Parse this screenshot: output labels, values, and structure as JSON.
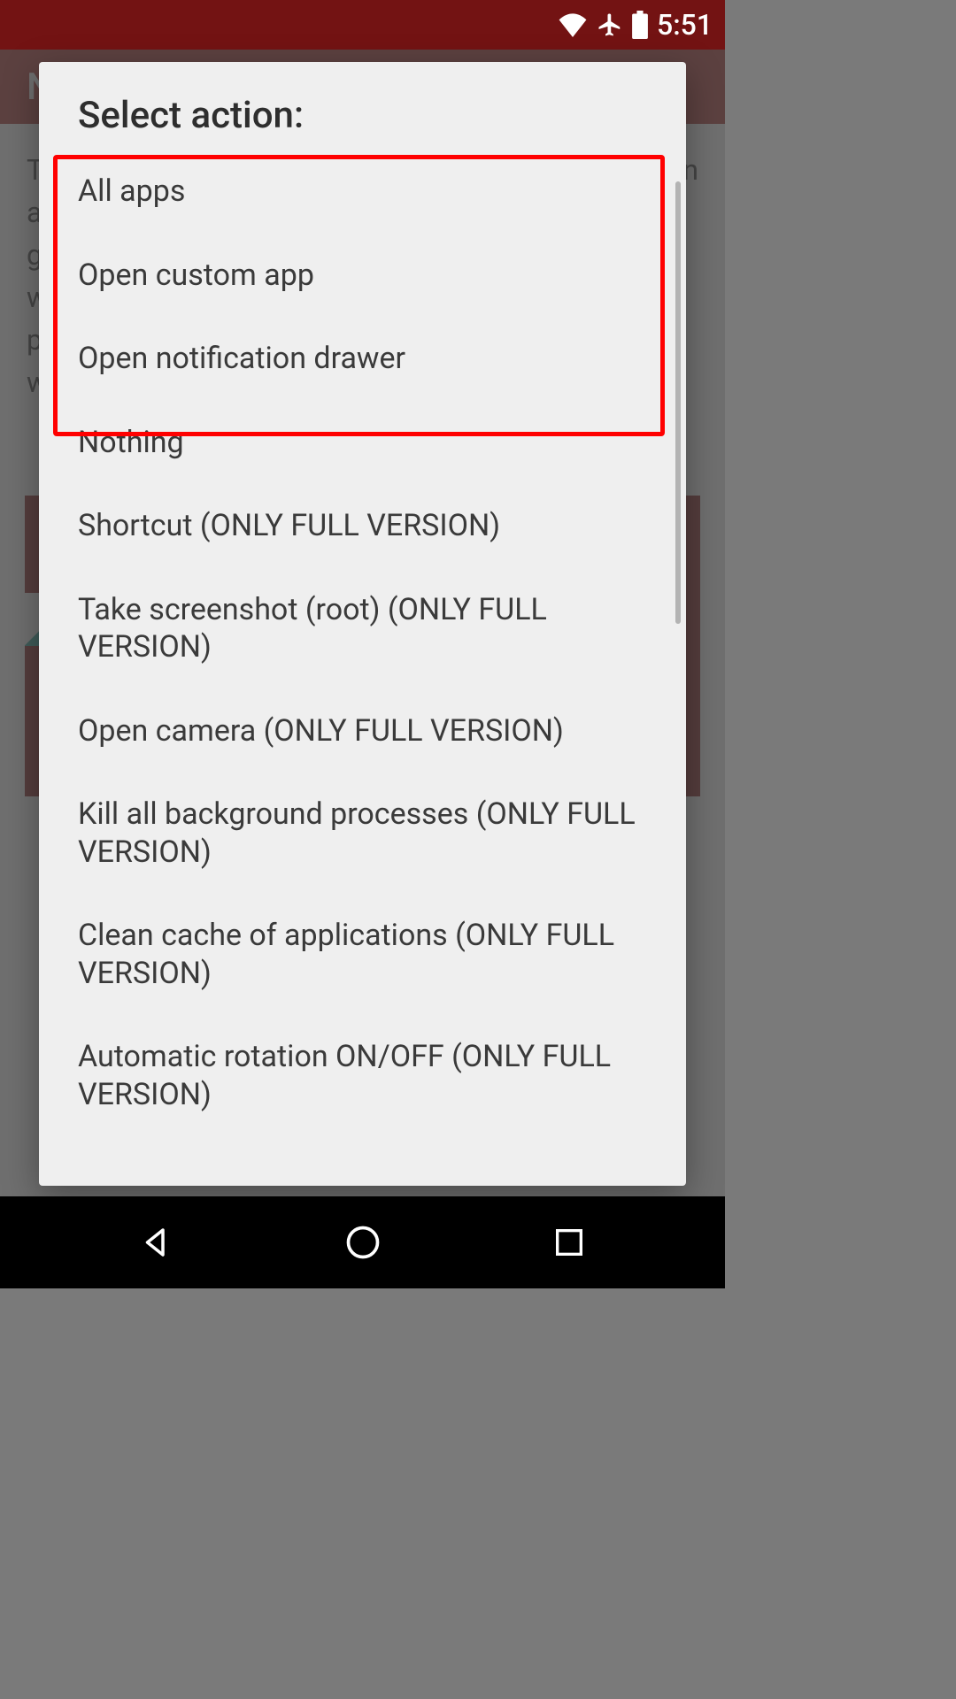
{
  "status_bar": {
    "time": "5:51"
  },
  "action_bar": {
    "title_initial": "N"
  },
  "page": {
    "line1": "T",
    "line2": "a",
    "line3": "g",
    "line4": "w",
    "line5": "p",
    "line6": "w",
    "trailing": "n"
  },
  "dialog": {
    "title": "Select action:",
    "items": [
      {
        "label": "All apps"
      },
      {
        "label": "Open custom app"
      },
      {
        "label": "Open notification drawer"
      },
      {
        "label": "Nothing"
      },
      {
        "label": "Shortcut (ONLY FULL VERSION)"
      },
      {
        "label": "Take screenshot (root) (ONLY FULL VERSION)"
      },
      {
        "label": "Open camera (ONLY FULL VERSION)"
      },
      {
        "label": "Kill all background processes (ONLY FULL VERSION)"
      },
      {
        "label": "Clean cache of applications (ONLY FULL VERSION)"
      },
      {
        "label": "Automatic rotation ON/OFF (ONLY FULL VERSION)"
      }
    ]
  }
}
